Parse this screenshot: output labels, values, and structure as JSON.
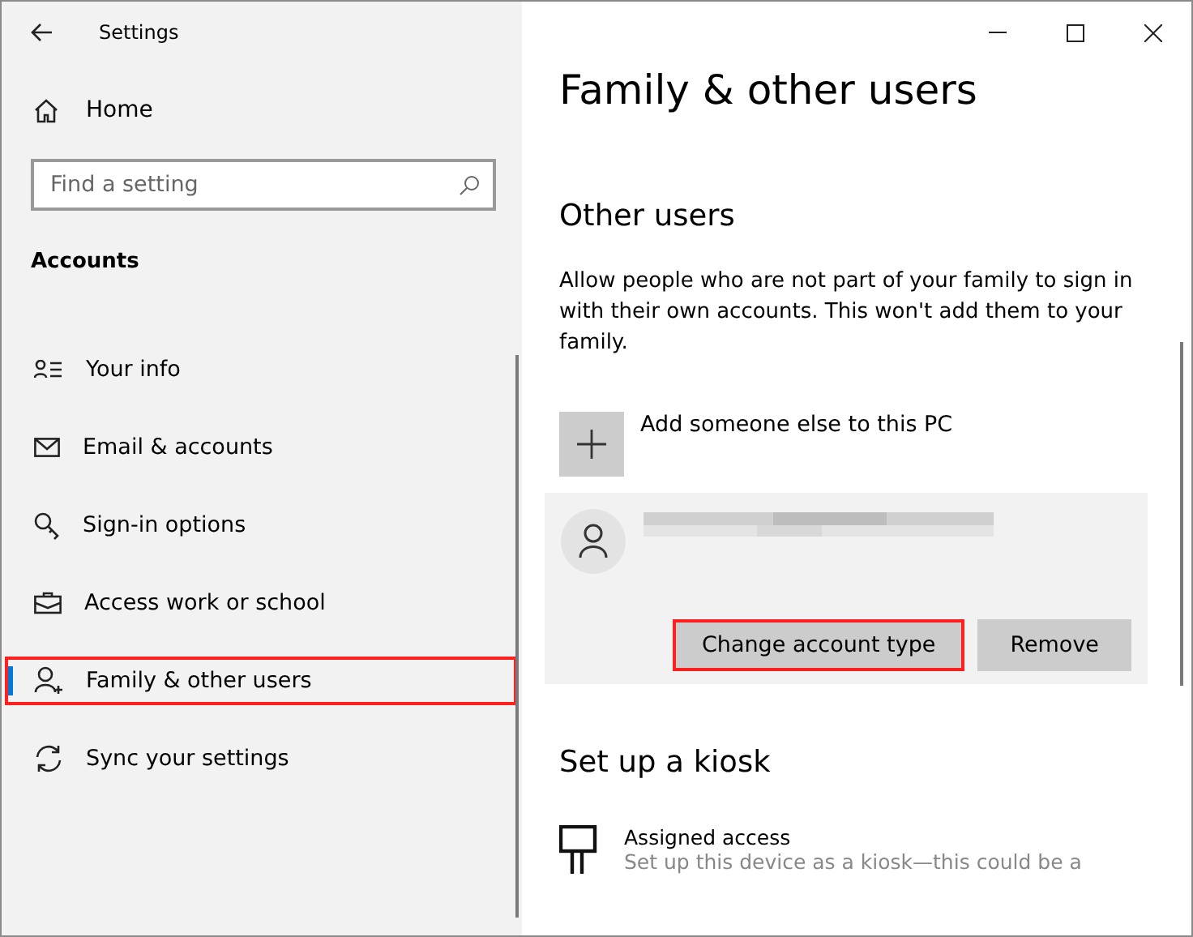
{
  "window": {
    "title": "Settings"
  },
  "sidebar": {
    "home": "Home",
    "search": {
      "placeholder": "Find a setting"
    },
    "section": "Accounts",
    "items": [
      {
        "label": "Your info",
        "kind": "info",
        "selected": false,
        "highlighted": false
      },
      {
        "label": "Email & accounts",
        "kind": "mail",
        "selected": false,
        "highlighted": false
      },
      {
        "label": "Sign-in options",
        "kind": "key",
        "selected": false,
        "highlighted": false
      },
      {
        "label": "Access work or school",
        "kind": "briefcase",
        "selected": false,
        "highlighted": false
      },
      {
        "label": "Family & other users",
        "kind": "family",
        "selected": true,
        "highlighted": true
      },
      {
        "label": "Sync your settings",
        "kind": "sync",
        "selected": false,
        "highlighted": false
      }
    ]
  },
  "content": {
    "title": "Family & other users",
    "section": "Other users",
    "description": "Allow people who are not part of your family to sign in with their own accounts. This won't add them to your family.",
    "add_user": "Add someone else to this PC",
    "user_card": {
      "buttons": [
        {
          "label": "Change account type",
          "highlighted": true
        },
        {
          "label": "Remove",
          "highlighted": false
        }
      ]
    },
    "kiosk": {
      "title": "Set up a kiosk",
      "item_title": "Assigned access",
      "item_text": "Set up this device as a kiosk—this could be a"
    }
  }
}
